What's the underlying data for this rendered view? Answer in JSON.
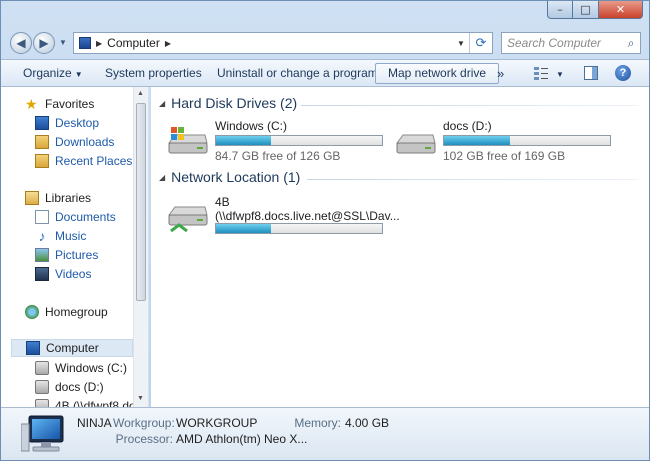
{
  "window": {
    "controls": {
      "minimize": "–",
      "maximize": "□",
      "close": "✕"
    }
  },
  "address": {
    "crumbs": [
      "Computer"
    ],
    "search_placeholder": "Search Computer"
  },
  "toolbar": {
    "organize": "Organize",
    "system_properties": "System properties",
    "uninstall": "Uninstall or change a program",
    "map_drive": "Map network drive",
    "more": "»"
  },
  "nav": {
    "favorites": {
      "label": "Favorites",
      "items": [
        "Desktop",
        "Downloads",
        "Recent Places"
      ]
    },
    "libraries": {
      "label": "Libraries",
      "items": [
        "Documents",
        "Music",
        "Pictures",
        "Videos"
      ]
    },
    "homegroup": "Homegroup",
    "computer": {
      "label": "Computer",
      "items": [
        "Windows (C:)",
        "docs (D:)",
        "4B (\\\\dfwpf8.doc"
      ]
    }
  },
  "groups": {
    "hdd": "Hard Disk Drives (2)",
    "network": "Network Location (1)"
  },
  "drives": [
    {
      "name": "Windows (C:)",
      "free_text": "84.7 GB free of 126 GB",
      "used_fraction": 0.33
    },
    {
      "name": "docs (D:)",
      "free_text": "102 GB free of 169 GB",
      "used_fraction": 0.4
    }
  ],
  "network_drive": {
    "name": "4B",
    "path": "(\\\\dfwpf8.docs.live.net@SSL\\Dav...",
    "used_fraction": 0.33
  },
  "details": {
    "computer_name": "NINJA",
    "workgroup_label": "Workgroup:",
    "workgroup_value": "WORKGROUP",
    "memory_label": "Memory:",
    "memory_value": "4.00 GB",
    "processor_label": "Processor:",
    "processor_value": "AMD Athlon(tm) Neo X..."
  }
}
